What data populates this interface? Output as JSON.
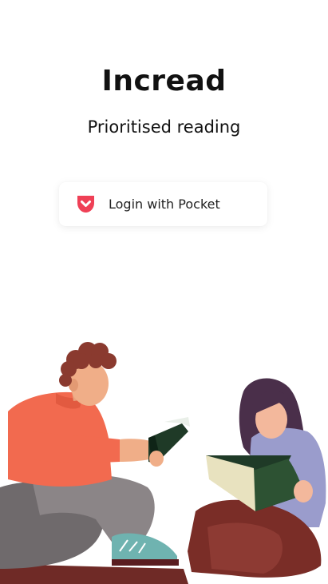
{
  "app": {
    "title": "Incread",
    "subtitle": "Prioritised reading"
  },
  "login": {
    "label": "Login with Pocket",
    "icon": "pocket-icon",
    "icon_color": "#ef4056"
  },
  "illustration": {
    "icon": "people-reading-illustration"
  }
}
